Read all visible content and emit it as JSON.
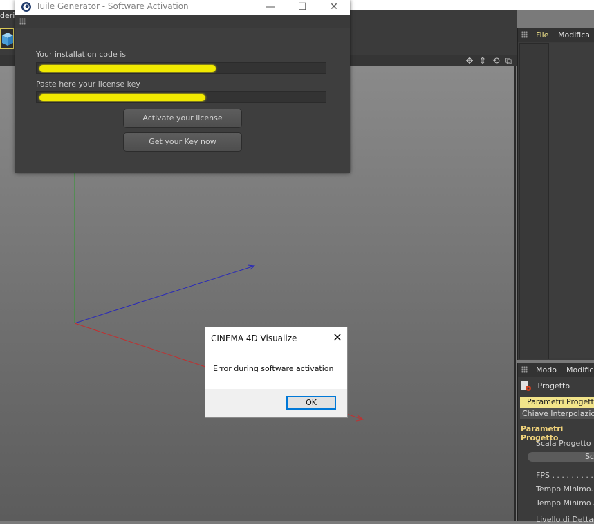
{
  "background_app": {
    "menu_partial": "deri",
    "right_top_menu": [
      "File",
      "Modifica"
    ],
    "right_bottom_menu": [
      "Modo",
      "Modific"
    ],
    "attributes": {
      "project_label": "Progetto",
      "tab_active": "Parametri Progetto",
      "tab_other": "Chiave Interpolazion",
      "section_title": "Parametri Progetto",
      "rows": [
        "Scala Progetto . .",
        "FPS . . . . . . . . . . .",
        "Tempo Minimo. . .",
        "Tempo Minimo A",
        "Livello di Dettag"
      ],
      "scala_field_value": "Sc"
    },
    "viewport_icons": "✥ ⇕ ⟲ ⧉"
  },
  "tuile_window": {
    "title": "Tuile Generator - Software Activation",
    "controls": {
      "minimize": "—",
      "maximize": "☐",
      "close": "✕"
    },
    "installation_label": "Your installation code is",
    "license_label": "Paste here your license key",
    "activate_button": "Activate your license",
    "getkey_button": "Get your Key now",
    "redaction_color": "#f1ea00"
  },
  "dialog": {
    "title": "CINEMA 4D Visualize",
    "close": "✕",
    "message": "Error during software activation",
    "ok_button": "OK"
  },
  "colors": {
    "axis_y": "#2e9a2e",
    "axis_x": "#c03030",
    "axis_z": "#2a2ab8",
    "highlight": "#f2e48a"
  }
}
